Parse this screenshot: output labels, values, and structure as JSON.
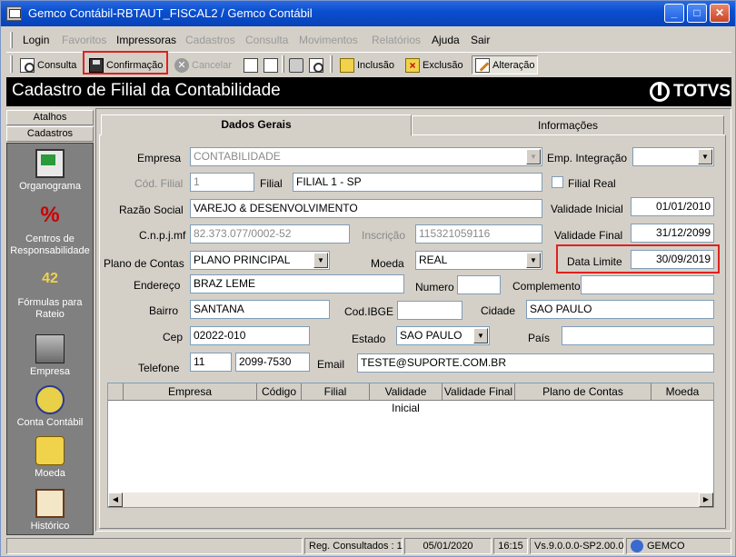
{
  "window": {
    "title": "Gemco Contábil-RBTAUT_FISCAL2 / Gemco Contábil"
  },
  "menu": [
    {
      "label": "Login",
      "enabled": true
    },
    {
      "label": "Favoritos",
      "enabled": false
    },
    {
      "label": "Impressoras",
      "enabled": true
    },
    {
      "label": "Cadastros",
      "enabled": false
    },
    {
      "label": "Consulta",
      "enabled": false
    },
    {
      "label": "Movimentos",
      "enabled": false
    },
    {
      "label": "Relatórios",
      "enabled": false
    },
    {
      "label": "Ajuda",
      "enabled": true
    },
    {
      "label": "Sair",
      "enabled": true
    }
  ],
  "toolbar": {
    "consulta": "Consulta",
    "confirmacao": "Confirmação",
    "cancelar": "Cancelar",
    "inclusao": "Inclusão",
    "exclusao": "Exclusão",
    "alteracao": "Alteração"
  },
  "header": {
    "title": "Cadastro de Filial da Contabilidade",
    "logo": "TOTVS"
  },
  "side": {
    "tabs": [
      "Atalhos",
      "Cadastros"
    ],
    "items": [
      "Organograma",
      "Centros de Responsabilidade",
      "Fórmulas para Rateio",
      "Empresa",
      "Conta Contábil",
      "Moeda",
      "Histórico"
    ]
  },
  "tabs": [
    "Dados Gerais",
    "Informações"
  ],
  "form": {
    "empresa_label": "Empresa",
    "empresa_value": "CONTABILIDADE",
    "emp_integracao_label": "Emp. Integração",
    "emp_integracao_value": "",
    "cod_filial_label": "Cód. Filial",
    "cod_filial_value": "1",
    "filial_label": "Filial",
    "filial_value": "FILIAL 1 - SP",
    "filial_real_label": "Filial Real",
    "razao_label": "Razão Social",
    "razao_value": "VAREJO & DESENVOLVIMENTO",
    "validade_inicial_label": "Validade Inicial",
    "validade_inicial_value": "01/01/2010",
    "cnpj_label": "C.n.p.j.mf",
    "cnpj_value": "82.373.077/0002-52",
    "inscricao_label": "Inscrição",
    "inscricao_value": "115321059116",
    "validade_final_label": "Validade Final",
    "validade_final_value": "31/12/2099",
    "plano_label": "Plano de Contas",
    "plano_value": "PLANO PRINCIPAL",
    "moeda_label": "Moeda",
    "moeda_value": "REAL",
    "data_limite_label": "Data Limite",
    "data_limite_value": "30/09/2019",
    "endereco_label": "Endereço",
    "endereco_value": "BRAZ LEME",
    "numero_label": "Numero",
    "numero_value": "",
    "complemento_label": "Complemento",
    "complemento_value": "",
    "bairro_label": "Bairro",
    "bairro_value": "SANTANA",
    "codibge_label": "Cod.IBGE",
    "codibge_value": "",
    "cidade_label": "Cidade",
    "cidade_value": "SAO PAULO",
    "cep_label": "Cep",
    "cep_value": "02022-010",
    "estado_label": "Estado",
    "estado_value": "SAO PAULO",
    "pais_label": "País",
    "pais_value": "",
    "telefone_label": "Telefone",
    "ddd_value": "11",
    "telefone_value": "2099-7530",
    "email_label": "Email",
    "email_value": "TESTE@SUPORTE.COM.BR"
  },
  "grid": {
    "columns": [
      "Empresa",
      "Código",
      "Filial",
      "Validade Inicial",
      "Validade Final",
      "Plano de Contas",
      "Moeda"
    ]
  },
  "status": {
    "registros": "Reg. Consultados : 1",
    "data": "05/01/2020",
    "hora": "16:15",
    "versao": "Vs.9.0.0.0-SP2.00.0",
    "usuario": "GEMCO"
  }
}
